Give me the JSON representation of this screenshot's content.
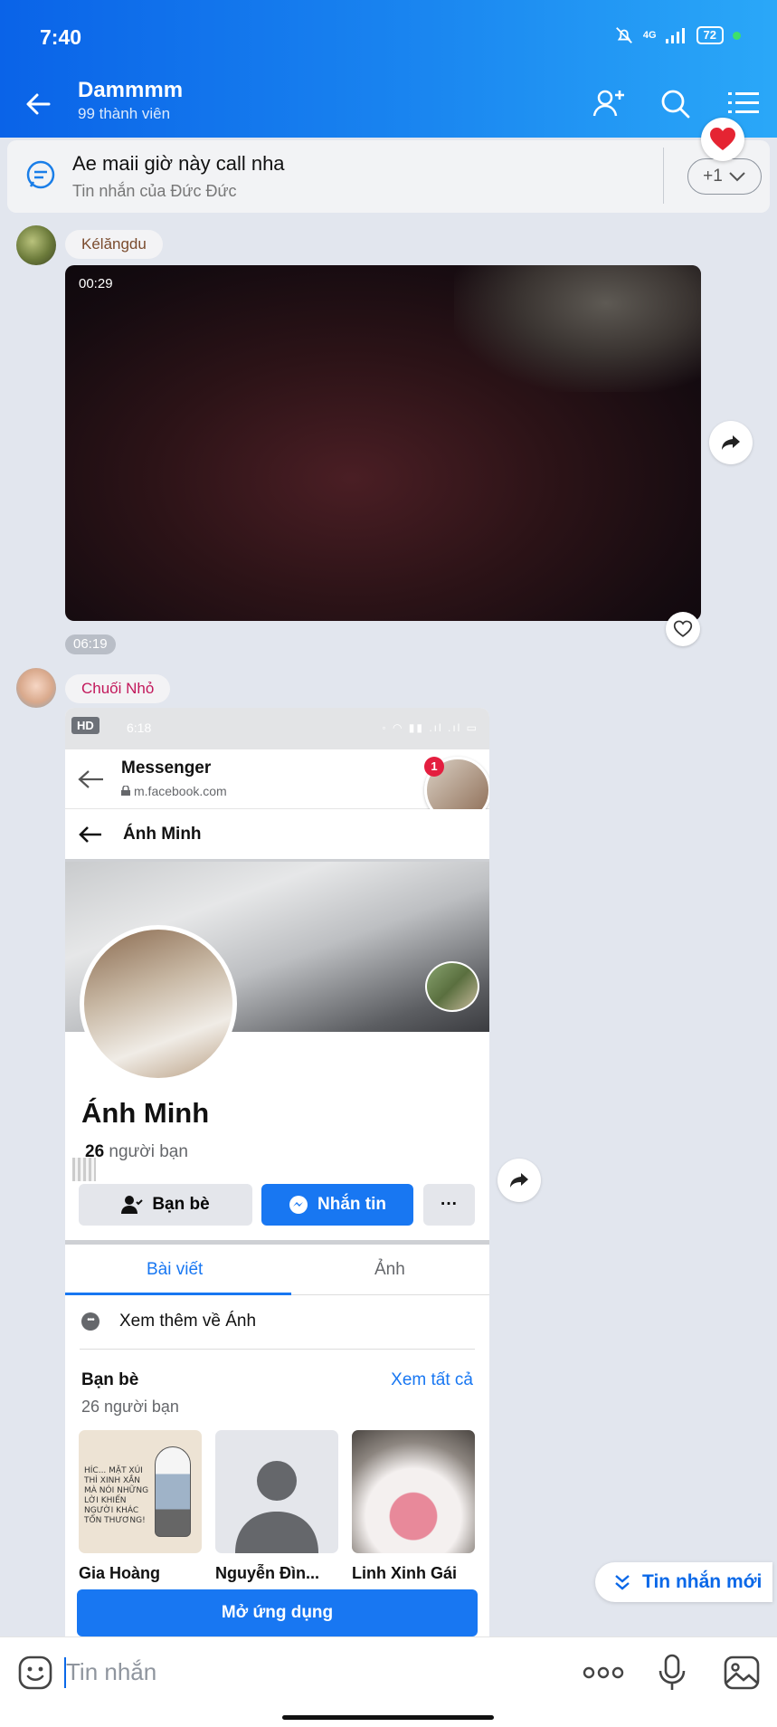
{
  "status_bar": {
    "time": "7:40",
    "network": "4G",
    "battery": "72"
  },
  "header": {
    "group_name": "Dammmm",
    "member_count": "99 thành viên"
  },
  "pinned": {
    "text": "Ae maii giờ này call nha",
    "author": "Tin nhắn của Đức Đức",
    "expand_label": "+1"
  },
  "messages": [
    {
      "sender": "Kélăngdu",
      "sender_color": "#7a4b2d",
      "video_duration": "00:29",
      "time": "06:19"
    },
    {
      "sender": "Chuối Nhỏ",
      "sender_color": "#c2185b"
    }
  ],
  "embedded": {
    "hd": "HD",
    "phone_time": "6:18",
    "app_name": "Messenger",
    "url": "m.facebook.com",
    "bubble_badge": "1",
    "nav_title": "Ánh Minh",
    "profile_name": "Ánh Minh",
    "friends_count_num": "26",
    "friends_count_text": " người bạn",
    "btn_friends": "Bạn bè",
    "btn_message": "Nhắn tin",
    "btn_more": "···",
    "tab_posts": "Bài viết",
    "tab_photos": "Ảnh",
    "more_about": "Xem thêm về Ánh",
    "friends_heading": "Bạn bè",
    "friends_sub": "26 người bạn",
    "see_all": "Xem tất cả",
    "friends": [
      {
        "name": "Gia Hoàng",
        "caption": "HÍC... MẶT XÚI THÌ XINH XẮN MÀ NÓI NHỮNG LỜI KHIẾN NGƯỜI KHÁC TỔN THƯƠNG!"
      },
      {
        "name": "Nguyễn Đìn..."
      },
      {
        "name": "Linh Xinh Gái"
      }
    ],
    "open_app": "Mở ứng dụng"
  },
  "new_messages_label": "Tin nhắn mới",
  "input": {
    "placeholder": "Tin nhắn"
  },
  "icons": [
    "back-arrow-icon",
    "add-member-icon",
    "search-icon",
    "menu-icon",
    "pinned-chat-icon",
    "heart-icon",
    "share-icon",
    "emoji-icon",
    "more-dots-icon",
    "mic-icon",
    "image-icon"
  ],
  "colors": {
    "header_start": "#0a63e8",
    "header_end": "#2aa8f8",
    "accent": "#0a68e8",
    "facebook_blue": "#1877f2"
  }
}
